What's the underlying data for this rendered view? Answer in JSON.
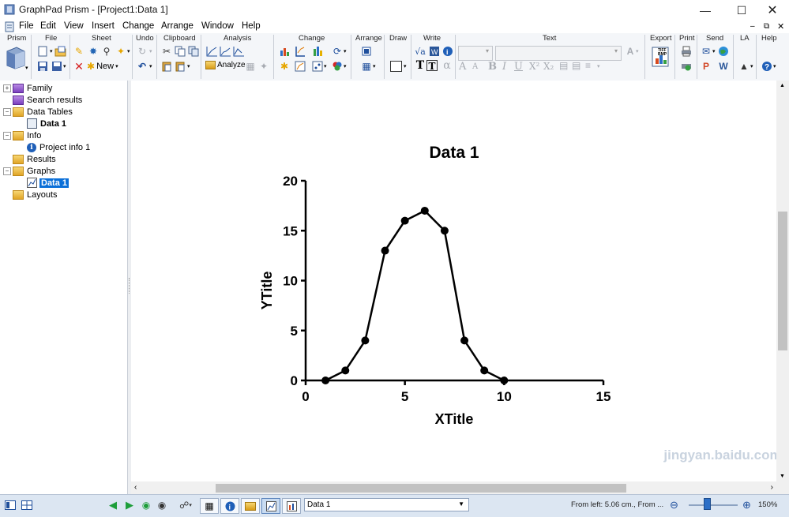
{
  "window": {
    "title": "GraphPad Prism - [Project1:Data 1]"
  },
  "menu": [
    "File",
    "Edit",
    "View",
    "Insert",
    "Change",
    "Arrange",
    "Window",
    "Help"
  ],
  "ribbon": {
    "groups": [
      "Prism",
      "File",
      "Sheet",
      "Undo",
      "Clipboard",
      "Analysis",
      "Change",
      "Arrange",
      "Draw",
      "Write",
      "Text",
      "Export",
      "Print",
      "Send",
      "LA",
      "Help"
    ],
    "sheet_new_label": "New",
    "analyze_label": "Analyze",
    "export_icon_text": "TIFF BMP"
  },
  "navigator": {
    "items": [
      {
        "label": "Family"
      },
      {
        "label": "Search results"
      },
      {
        "label": "Data Tables"
      },
      {
        "label": "Data 1"
      },
      {
        "label": "Info"
      },
      {
        "label": "Project info 1"
      },
      {
        "label": "Results"
      },
      {
        "label": "Graphs"
      },
      {
        "label": "Data 1"
      },
      {
        "label": "Layouts"
      }
    ]
  },
  "statusbar": {
    "sheet_selected": "Data 1",
    "position_text": "From left: 5.06 cm., From ...",
    "zoom": "150%"
  },
  "watermark": {
    "text": "jingyan.baidu.com"
  },
  "chart_data": {
    "type": "line",
    "title": "Data 1",
    "xlabel": "XTitle",
    "ylabel": "YTitle",
    "x": [
      1,
      2,
      3,
      4,
      5,
      6,
      7,
      8,
      9,
      10
    ],
    "series": [
      {
        "values": [
          0,
          1,
          4,
          13,
          16,
          17,
          15,
          4,
          1,
          0
        ]
      }
    ],
    "xlim": [
      0,
      15
    ],
    "ylim": [
      0,
      20
    ],
    "xticks": [
      0,
      5,
      10,
      15
    ],
    "yticks": [
      0,
      5,
      10,
      15,
      20
    ],
    "marker": "circle",
    "color": "#000000",
    "grid": false
  }
}
